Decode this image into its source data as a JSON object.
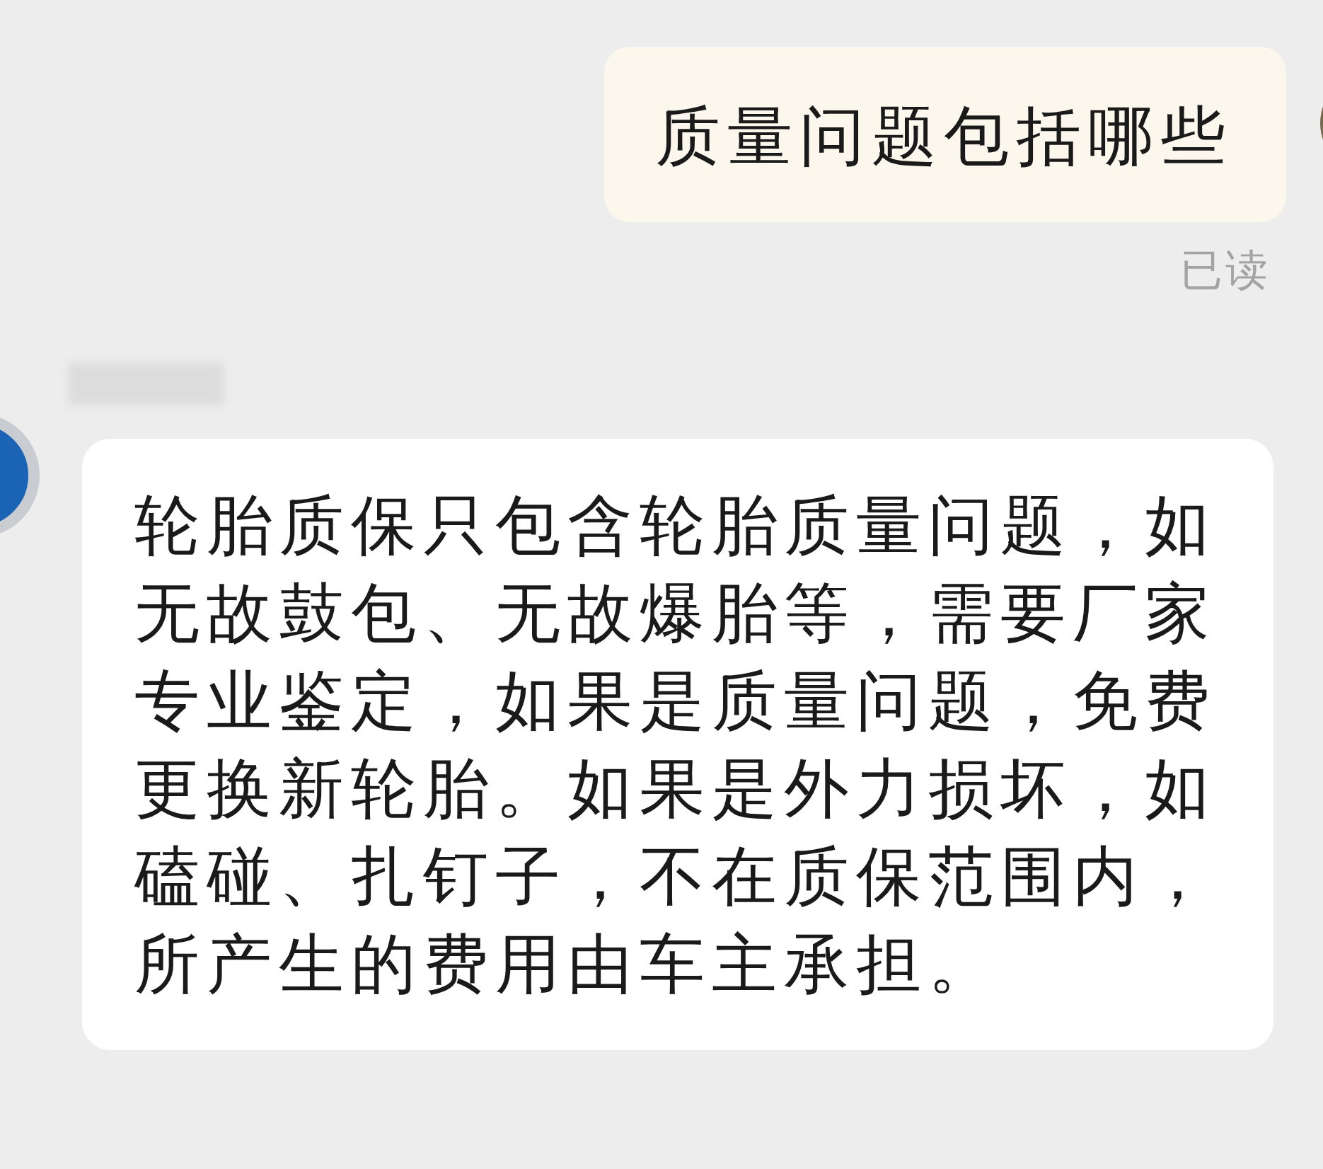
{
  "messages": [
    {
      "kind": "sent",
      "text": "质量问题包括哪些",
      "status": "已读"
    },
    {
      "kind": "received",
      "text": "轮胎质保只包含轮胎质量问题，如无故鼓包、无故爆胎等，需要厂家专业鉴定，如果是质量问题，免费更换新轮胎。如果是外力损坏，如磕碰、扎钉子，不在质保范围内，所产生的费用由车主承担。"
    }
  ]
}
